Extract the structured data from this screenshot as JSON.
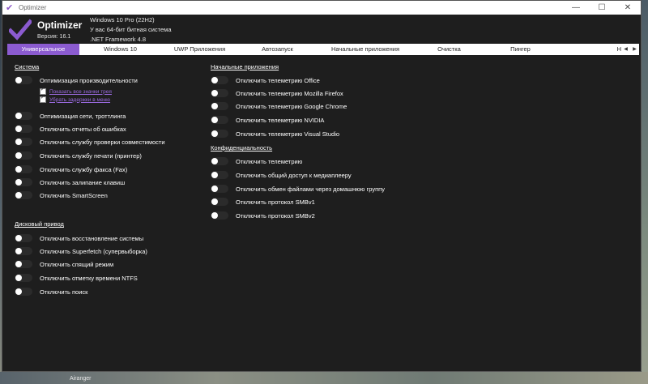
{
  "window": {
    "title": "Optimizer",
    "minimize": "—",
    "maximize": "☐",
    "close": "✕"
  },
  "header": {
    "app_name": "Optimizer",
    "version": "Версия: 16.1",
    "os": "Windows 10 Pro (22H2)",
    "arch": "У вас 64-бит битная система",
    "framework": ".NET Framework 4.8"
  },
  "tabs": [
    {
      "label": "Универсальное"
    },
    {
      "label": "Windows 10"
    },
    {
      "label": "UWP Приложения"
    },
    {
      "label": "Автозапуск"
    },
    {
      "label": "Начальные приложения"
    },
    {
      "label": "Очистка"
    },
    {
      "label": "Пингер"
    },
    {
      "label": "Н"
    }
  ],
  "tab_nav": {
    "prev": "◀",
    "next": "▶"
  },
  "sections": {
    "system": {
      "title": "Система",
      "items": [
        "Оптимизация производительности",
        "Оптимизация сети, троттлинга",
        "Отключить отчеты об ошибках",
        "Отключить службу проверки совместимости",
        "Отключить службу печати (принтер)",
        "Отключить службу факса (Fax)",
        "Отключить залипание клавиш",
        "Отключить SmartScreen"
      ],
      "sub_options": [
        "Показать все значки трея",
        "Убрать задержки в меню"
      ]
    },
    "disk": {
      "title": "Дисковый привод",
      "items": [
        "Отключить восстановление системы",
        "Отключить Superfetch (супервыборка)",
        "Отключить спящий режим",
        "Отключить отметку времени NTFS",
        "Отключить поиск"
      ]
    },
    "startup_apps": {
      "title": "Начальные приложения",
      "items": [
        "Отключить телеметрию Office",
        "Отключить телеметрию Mozilla Firefox",
        "Отключить телеметрию Google Chrome",
        "Отключить телеметрию NVIDIA",
        "Отключить телеметрию Visual Studio"
      ]
    },
    "privacy": {
      "title": "Конфиденциальность",
      "items": [
        "Отключить телеметрию",
        "Отключить общий доступ к медиаплееру",
        "Отключить обмен файлами через домашнюю группу",
        "Отключить протокол SMBv1",
        "Отключить протокол SMBv2"
      ]
    }
  },
  "desktop": {
    "taskbar_label": "Airanger"
  },
  "colors": {
    "accent": "#8b5bd0",
    "background": "#1e1e1e",
    "link": "#9a6ae0"
  }
}
